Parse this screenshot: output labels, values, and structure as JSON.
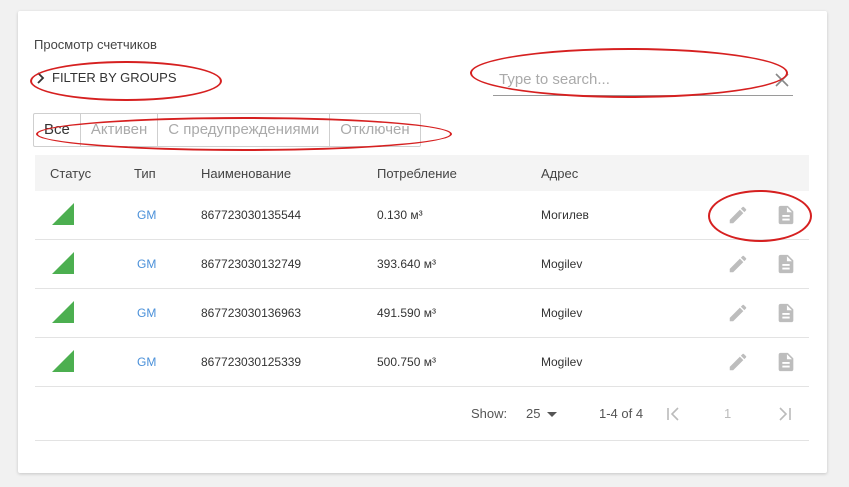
{
  "title": "Просмотр счетчиков",
  "filter_label": "FILTER BY GROUPS",
  "search_placeholder": "Type to search...",
  "segments": [
    "Все",
    "Активен",
    "С предупреждениями",
    "Отключен"
  ],
  "columns": {
    "status": "Статус",
    "type": "Тип",
    "name": "Наименование",
    "consumption": "Потребление",
    "address": "Адрес"
  },
  "rows": [
    {
      "type": "GM",
      "name": "867723030135544",
      "consumption": "0.130 м³",
      "address": "Могилев"
    },
    {
      "type": "GM",
      "name": "867723030132749",
      "consumption": "393.640 м³",
      "address": "Mogilev"
    },
    {
      "type": "GM",
      "name": "867723030136963",
      "consumption": "491.590 м³",
      "address": "Mogilev"
    },
    {
      "type": "GM",
      "name": "867723030125339",
      "consumption": "500.750 м³",
      "address": "Mogilev"
    }
  ],
  "footer": {
    "show_label": "Show:",
    "page_size": "25",
    "range": "1-4 of 4",
    "page": "1"
  },
  "colors": {
    "status": "#4caf50",
    "link": "#4a90d9",
    "annotation": "#d62020"
  },
  "icons": [
    "chevron-right-icon",
    "close-icon",
    "status-triangle-icon",
    "edit-icon",
    "document-icon",
    "dropdown-arrow-icon",
    "first-page-icon",
    "last-page-icon"
  ]
}
